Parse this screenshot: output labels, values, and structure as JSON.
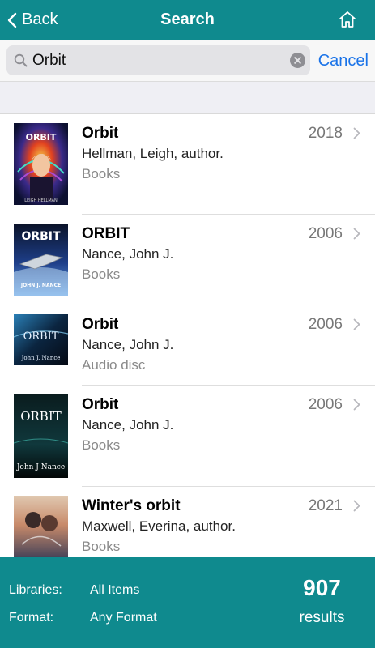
{
  "header": {
    "back_label": "Back",
    "title": "Search",
    "home_icon": "home-icon"
  },
  "search": {
    "value": "Orbit",
    "placeholder": "Search",
    "cancel_label": "Cancel"
  },
  "results": [
    {
      "title": "Orbit",
      "author": "Hellman, Leigh, author.",
      "format": "Books",
      "year": "2018"
    },
    {
      "title": "ORBIT",
      "author": "Nance, John J.",
      "format": "Books",
      "year": "2006"
    },
    {
      "title": "Orbit",
      "author": "Nance, John J.",
      "format": "Audio disc",
      "year": "2006"
    },
    {
      "title": "Orbit",
      "author": "Nance, John J.",
      "format": "Books",
      "year": "2006"
    },
    {
      "title": "Winter's orbit",
      "author": "Maxwell, Everina, author.",
      "format": "Books",
      "year": "2021"
    }
  ],
  "covers": {
    "c1_title": "ORBIT",
    "c1_author": "LEIGH HELLMAN",
    "c2_title": "ORBIT",
    "c2_author": "JOHN J. NANCE",
    "c3_title": "ORBIT",
    "c3_author": "John J. Nance",
    "c4_title": "ORBIT",
    "c4_author": "John J Nance"
  },
  "footer": {
    "libraries_label": "Libraries:",
    "libraries_value": "All Items",
    "format_label": "Format:",
    "format_value": "Any Format",
    "count": "907",
    "count_label": "results"
  },
  "colors": {
    "brand": "#0f8a8e",
    "link": "#1a73e8"
  }
}
